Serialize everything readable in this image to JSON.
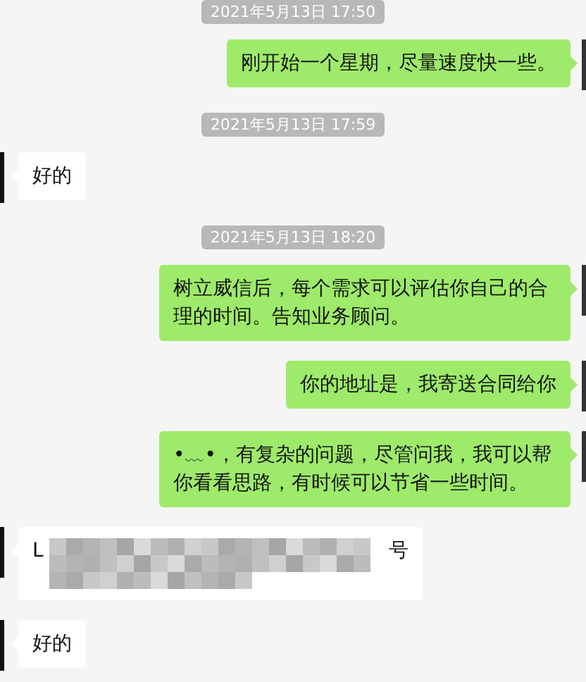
{
  "messages": [
    {
      "kind": "timestamp",
      "text": "2021年5月13日 17:50"
    },
    {
      "kind": "sent",
      "text": "刚开始一个星期，尽量速度快一些。"
    },
    {
      "kind": "timestamp",
      "text": "2021年5月13日 17:59"
    },
    {
      "kind": "received",
      "text": "好的"
    },
    {
      "kind": "timestamp",
      "text": "2021年5月13日 18:20"
    },
    {
      "kind": "sent",
      "text": "树立威信后，每个需求可以评估你自己的合理的时间。告知业务顾问。"
    },
    {
      "kind": "sent",
      "text": "你的地址是，我寄送合同给你"
    },
    {
      "kind": "sent",
      "text": "•﹏•，有复杂的问题，尽管问我，我可以帮你看看思路，有时候可以节省一些时间。"
    },
    {
      "kind": "redacted",
      "lead": "L",
      "tail": "号"
    },
    {
      "kind": "received",
      "text": "好的"
    }
  ]
}
